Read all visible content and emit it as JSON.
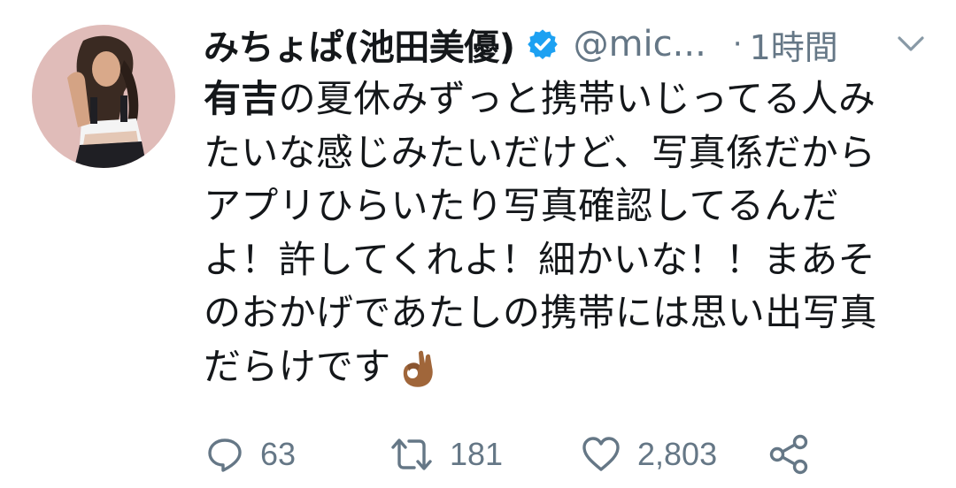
{
  "tweet": {
    "display_name": "みちょぱ(池田美優)",
    "handle": "@mic...",
    "separator": "·",
    "time": "1時間",
    "verified": true,
    "text": {
      "mention": "有吉",
      "lines": [
        "の夏休みずっと携帯いじってる人み",
        "たいな感じみたいだけど、写真係だから",
        "アプリひらいたり写真確認してるんだ",
        "よ！許してくれよ！細かいな！！まあそ",
        "のおかげであたしの携帯には思い出写真",
        "だらけです"
      ],
      "emoji": "ok-hand-medium-dark-skin"
    },
    "actions": {
      "reply_count": "63",
      "retweet_count": "181",
      "like_count": "2,803"
    }
  },
  "colors": {
    "text": "#14171a",
    "secondary": "#657786",
    "verified_blue": "#1da1f2",
    "emoji_skin": "#a0663a"
  },
  "icons": {
    "verified": "verified-badge-icon",
    "caret": "chevron-down-icon",
    "reply": "reply-bubble-icon",
    "retweet": "retweet-icon",
    "like": "heart-icon",
    "share": "share-icon"
  }
}
